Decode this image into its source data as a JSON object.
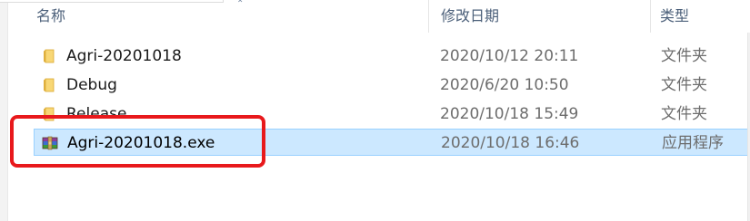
{
  "columns": {
    "name": "名称",
    "date_modified": "修改日期",
    "type": "类型"
  },
  "files": [
    {
      "name": "Agri-20201018",
      "date": "2020/10/12 20:11",
      "type": "文件夹",
      "icon": "folder-icon",
      "selected": false
    },
    {
      "name": "Debug",
      "date": "2020/6/20 10:50",
      "type": "文件夹",
      "icon": "folder-icon",
      "selected": false
    },
    {
      "name": "Release",
      "date": "2020/10/18 15:49",
      "type": "文件夹",
      "icon": "folder-icon",
      "selected": false
    },
    {
      "name": "Agri-20201018.exe",
      "date": "2020/10/18 16:46",
      "type": "应用程序",
      "icon": "winrar-exe-icon",
      "selected": true
    }
  ],
  "colors": {
    "selection_fill": "#cce8ff",
    "selection_border": "#99d1ff",
    "annotation_red": "#e8191c",
    "folder_yellow": "#f8d775"
  }
}
